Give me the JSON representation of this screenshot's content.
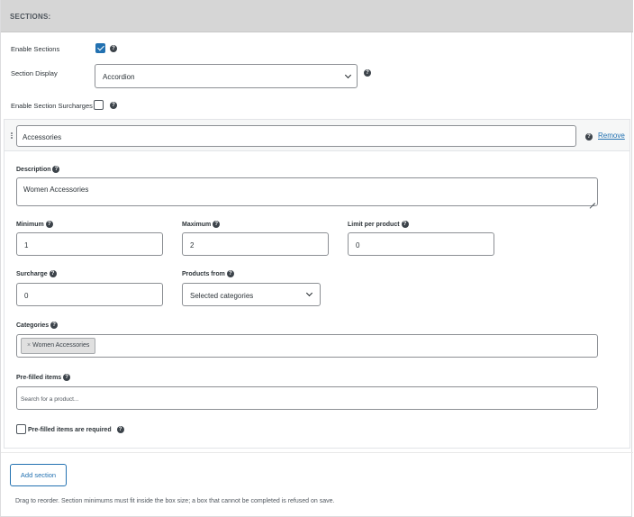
{
  "header": {
    "title": "SECTIONS:"
  },
  "settings": {
    "enable_sections": {
      "label": "Enable Sections",
      "checked": true
    },
    "section_display": {
      "label": "Section Display",
      "value": "Accordion"
    },
    "enable_surcharges": {
      "label": "Enable Section Surcharges",
      "checked": false
    }
  },
  "section": {
    "name": "Accessories",
    "remove_label": "Remove",
    "description": {
      "label": "Description",
      "value": "Women Accessories"
    },
    "minimum": {
      "label": "Minimum",
      "value": "1"
    },
    "maximum": {
      "label": "Maximum",
      "value": "2"
    },
    "limit_per_product": {
      "label": "Limit per product",
      "value": "0"
    },
    "surcharge": {
      "label": "Surcharge",
      "value": "0"
    },
    "products_from": {
      "label": "Products from",
      "value": "Selected categories"
    },
    "categories": {
      "label": "Categories",
      "tags": [
        {
          "remove": "×",
          "label": "Women Accessories"
        }
      ]
    },
    "prefilled_items": {
      "label": "Pre-filled items",
      "placeholder": "Search for a product..."
    },
    "prefilled_required": {
      "label": "Pre-filled items are required",
      "checked": false
    }
  },
  "actions": {
    "add_section": "Add section"
  },
  "footer": {
    "note": "Drag to reorder. Section minimums must fit inside the box size; a box that cannot be completed is refused on save."
  },
  "help_glyph": "?",
  "colors": {
    "accent": "#2271b1",
    "header_bg": "#d6d6d6",
    "checkbox_checked": "#2271b1"
  }
}
